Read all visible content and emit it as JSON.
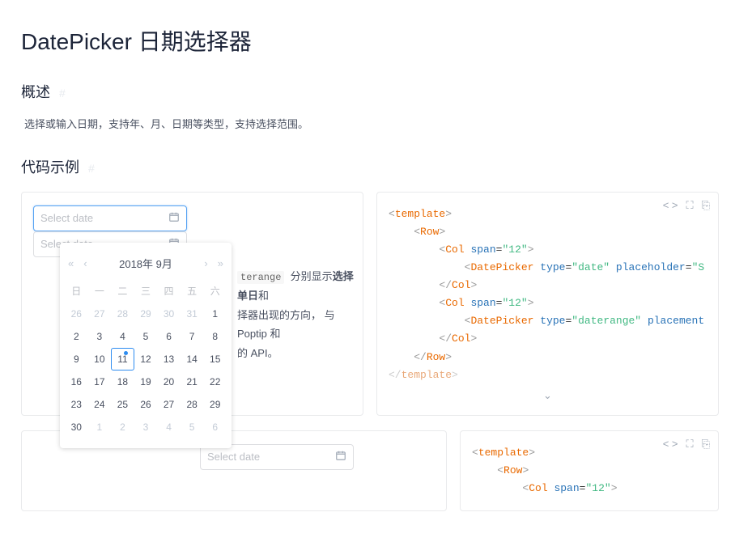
{
  "title": "DatePicker 日期选择器",
  "sections": {
    "overview": {
      "title": "概述",
      "desc": "选择或输入日期，支持年、月、日期等类型，支持选择范围。"
    },
    "examples": {
      "title": "代码示例"
    }
  },
  "placeholder": "Select date",
  "calendar": {
    "header": "2018年 9月",
    "nav": {
      "prevYear": "«",
      "prevMonth": "‹",
      "nextMonth": "›",
      "nextYear": "»"
    },
    "dow": [
      "日",
      "一",
      "二",
      "三",
      "四",
      "五",
      "六"
    ],
    "grid": [
      {
        "d": "26",
        "o": true
      },
      {
        "d": "27",
        "o": true
      },
      {
        "d": "28",
        "o": true
      },
      {
        "d": "29",
        "o": true
      },
      {
        "d": "30",
        "o": true
      },
      {
        "d": "31",
        "o": true
      },
      {
        "d": "1"
      },
      {
        "d": "2"
      },
      {
        "d": "3"
      },
      {
        "d": "4"
      },
      {
        "d": "5"
      },
      {
        "d": "6"
      },
      {
        "d": "7"
      },
      {
        "d": "8"
      },
      {
        "d": "9"
      },
      {
        "d": "10"
      },
      {
        "d": "11",
        "t": true
      },
      {
        "d": "12"
      },
      {
        "d": "13"
      },
      {
        "d": "14"
      },
      {
        "d": "15"
      },
      {
        "d": "16"
      },
      {
        "d": "17"
      },
      {
        "d": "18"
      },
      {
        "d": "19"
      },
      {
        "d": "20"
      },
      {
        "d": "21"
      },
      {
        "d": "22"
      },
      {
        "d": "23"
      },
      {
        "d": "24"
      },
      {
        "d": "25"
      },
      {
        "d": "26"
      },
      {
        "d": "27"
      },
      {
        "d": "28"
      },
      {
        "d": "29"
      },
      {
        "d": "30"
      },
      {
        "d": "1",
        "o": true
      },
      {
        "d": "2",
        "o": true
      },
      {
        "d": "3",
        "o": true
      },
      {
        "d": "4",
        "o": true
      },
      {
        "d": "5",
        "o": true
      },
      {
        "d": "6",
        "o": true
      }
    ]
  },
  "desc_block": {
    "p1_pre": "terange",
    "p1_mid": "分别显示",
    "p1_strong": "选择单日",
    "p1_after": "和",
    "p2": "择器出现的方向， 与 Poptip 和",
    "p3": "的 API。"
  },
  "code1": {
    "template": "template",
    "row": "Row",
    "col": "Col",
    "dp": "DatePicker",
    "span_attr": "span",
    "span_val": "\"12\"",
    "type_attr": "type",
    "type_date": "\"date\"",
    "type_daterange": "\"daterange\"",
    "ph_attr": "placeholder",
    "ph_val_cut": "\"S",
    "place_attr": "placement"
  },
  "code2": {
    "span_val": "\"12\""
  },
  "icons": {
    "code": "< >",
    "expand": "⛶",
    "copy": "⎘",
    "caret": "⌄",
    "anchor": "#"
  }
}
